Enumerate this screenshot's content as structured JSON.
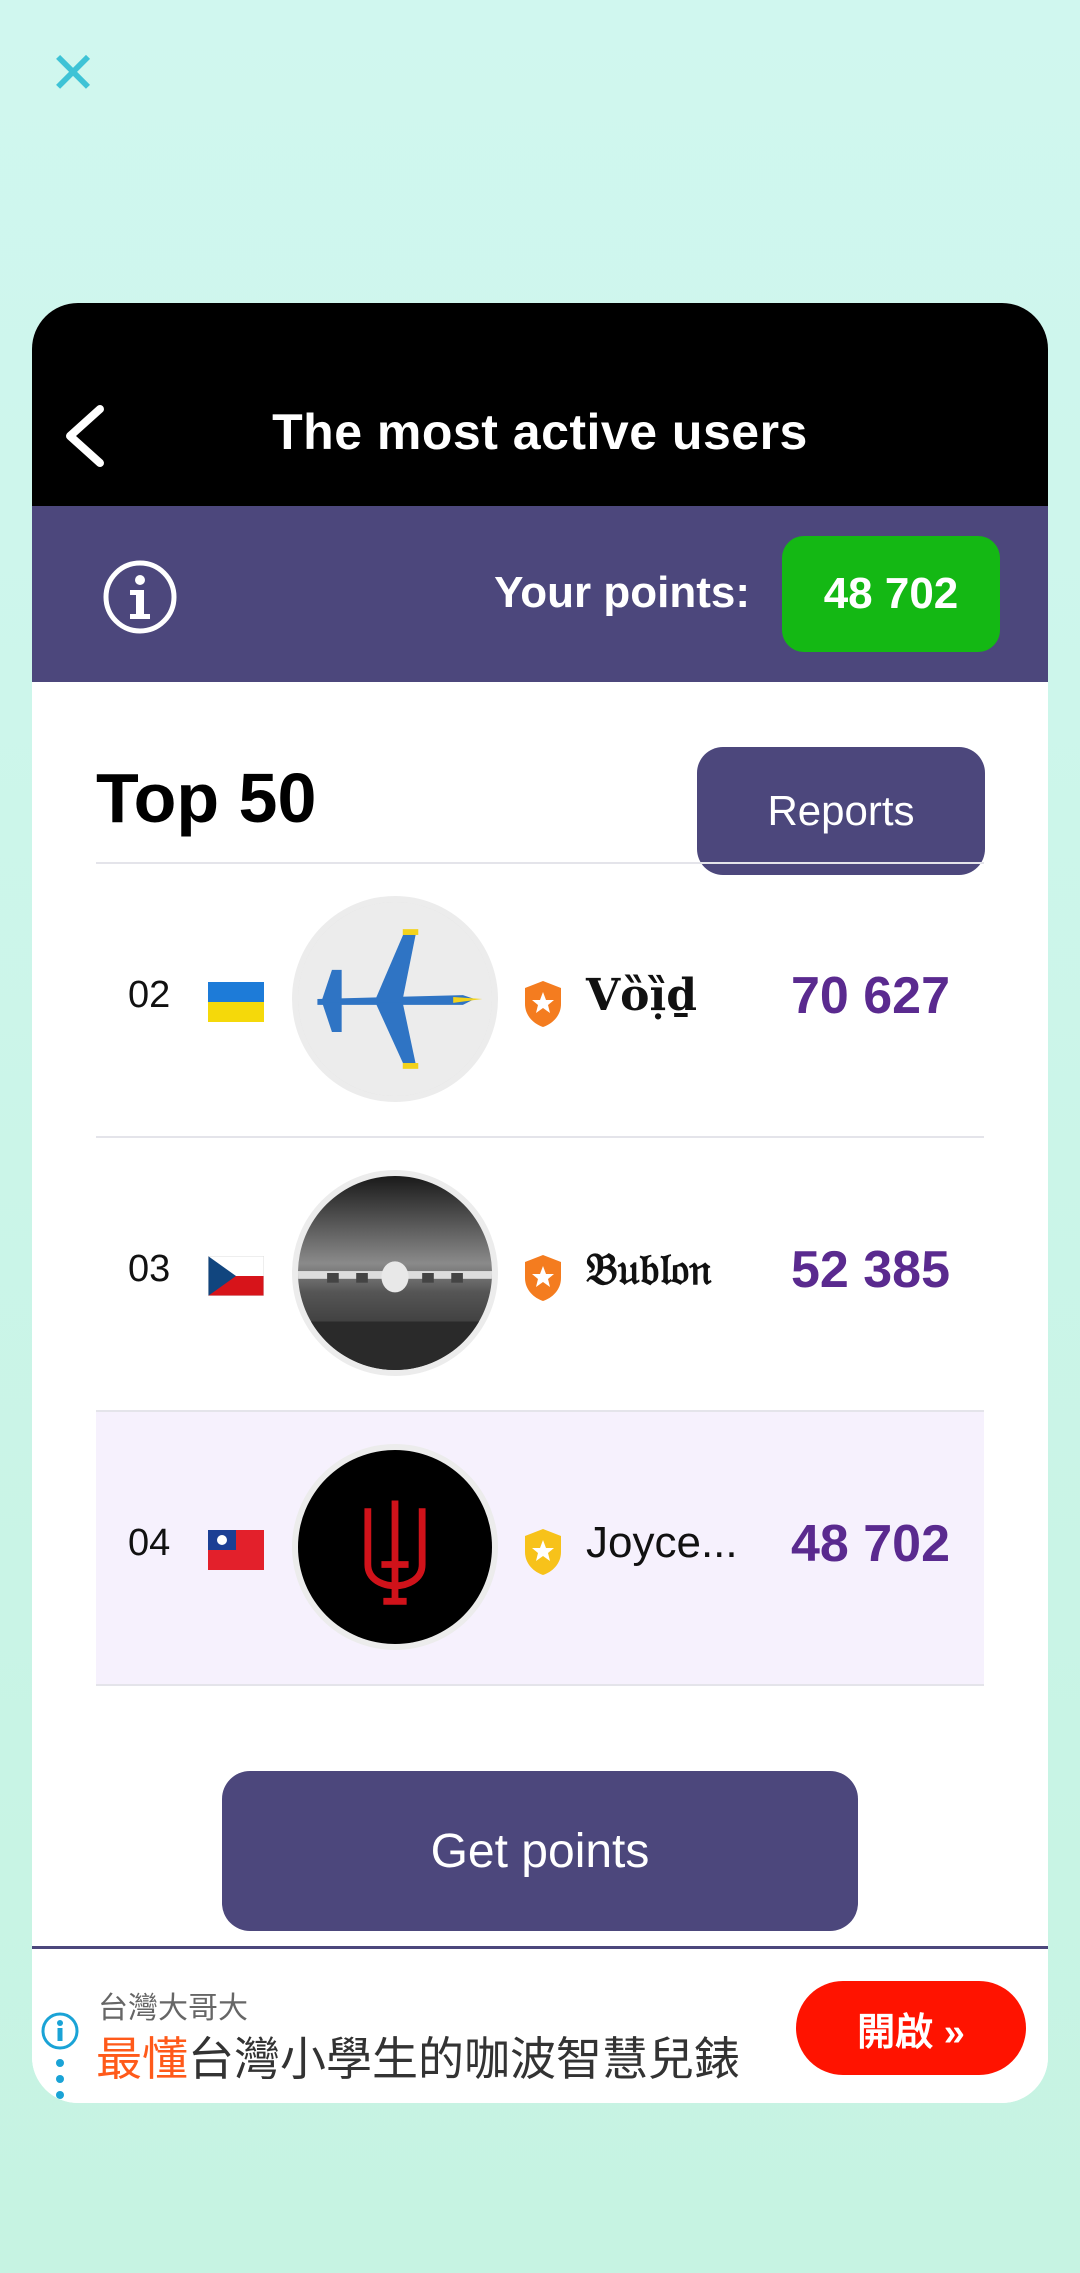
{
  "close": {
    "icon": "close-icon"
  },
  "header": {
    "title": "The most active users",
    "back_icon": "chevron-left-icon"
  },
  "points_bar": {
    "info_icon": "info-circle-icon",
    "label": "Your points:",
    "value": "48 702"
  },
  "leaderboard": {
    "title": "Top 50",
    "reports_label": "Reports",
    "rows": [
      {
        "rank": "02",
        "country": "Ukraine",
        "flag_icon": "flag-ua-icon",
        "avatar": "fighter-jet-avatar",
        "badge": "orange-shield-star-icon",
        "name": "Vȍị̏ḏ",
        "points": "70 627"
      },
      {
        "rank": "03",
        "country": "Czech Republic",
        "flag_icon": "flag-cz-icon",
        "avatar": "cargo-plane-avatar",
        "badge": "orange-shield-star-icon",
        "name": "𝔅𝔲𝔟𝔩𝔬𝔫",
        "points": "52 385"
      },
      {
        "rank": "04",
        "country": "Taiwan",
        "flag_icon": "flag-tw-icon",
        "avatar": "trident-avatar",
        "badge": "yellow-shield-star-icon",
        "name": "Joyce...",
        "points": "48 702"
      }
    ]
  },
  "actions": {
    "get_points_label": "Get points"
  },
  "ad": {
    "brand": "台灣大哥大",
    "text_highlight": "最懂",
    "text_rest": "台灣小學生的咖波智慧兒錶",
    "cta_label": "開啟 »",
    "colors": {
      "cta": "#ff1300",
      "highlight": "#ff5a1a"
    }
  },
  "colors": {
    "topbar": "#000000",
    "accent": "#4c477c",
    "points_badge": "#14b814",
    "score": "#5a2a8f",
    "highlight_row": "#f6f1fd"
  }
}
